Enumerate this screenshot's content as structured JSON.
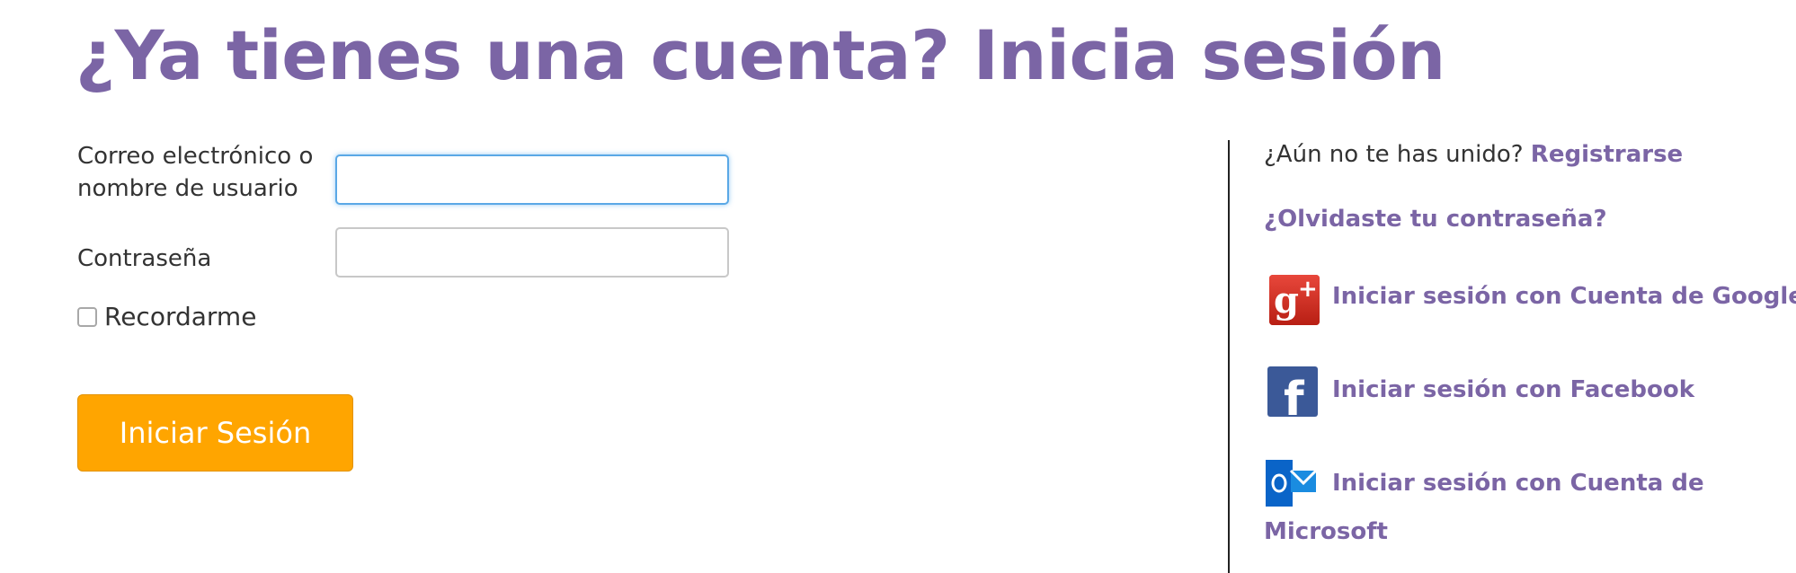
{
  "header": {
    "title": "¿Ya tienes una cuenta? Inicia sesión"
  },
  "form": {
    "email_label": "Correo electrónico o nombre de usuario",
    "email_value": "",
    "password_label": "Contraseña",
    "password_value": "",
    "remember_label": "Recordarme",
    "remember_checked": false,
    "submit_label": "Iniciar Sesión"
  },
  "sidebar": {
    "not_joined_text": "¿Aún no te has unido?",
    "register_link": "Registrarse",
    "forgot_link": "¿Olvidaste tu contraseña?",
    "social": [
      {
        "label": "Iniciar sesión con Cuenta de Google",
        "icon": "google-plus-icon"
      },
      {
        "label": "Iniciar sesión con Facebook",
        "icon": "facebook-icon"
      },
      {
        "label_line1": "Iniciar sesión con Cuenta de",
        "label_line2": "Microsoft",
        "icon": "outlook-icon"
      }
    ]
  },
  "colors": {
    "title": "#7b65a5",
    "link": "#7b65a5",
    "button": "#ffa500",
    "google": "#d62d20",
    "facebook": "#3b5998",
    "outlook": "#0a64c8"
  }
}
